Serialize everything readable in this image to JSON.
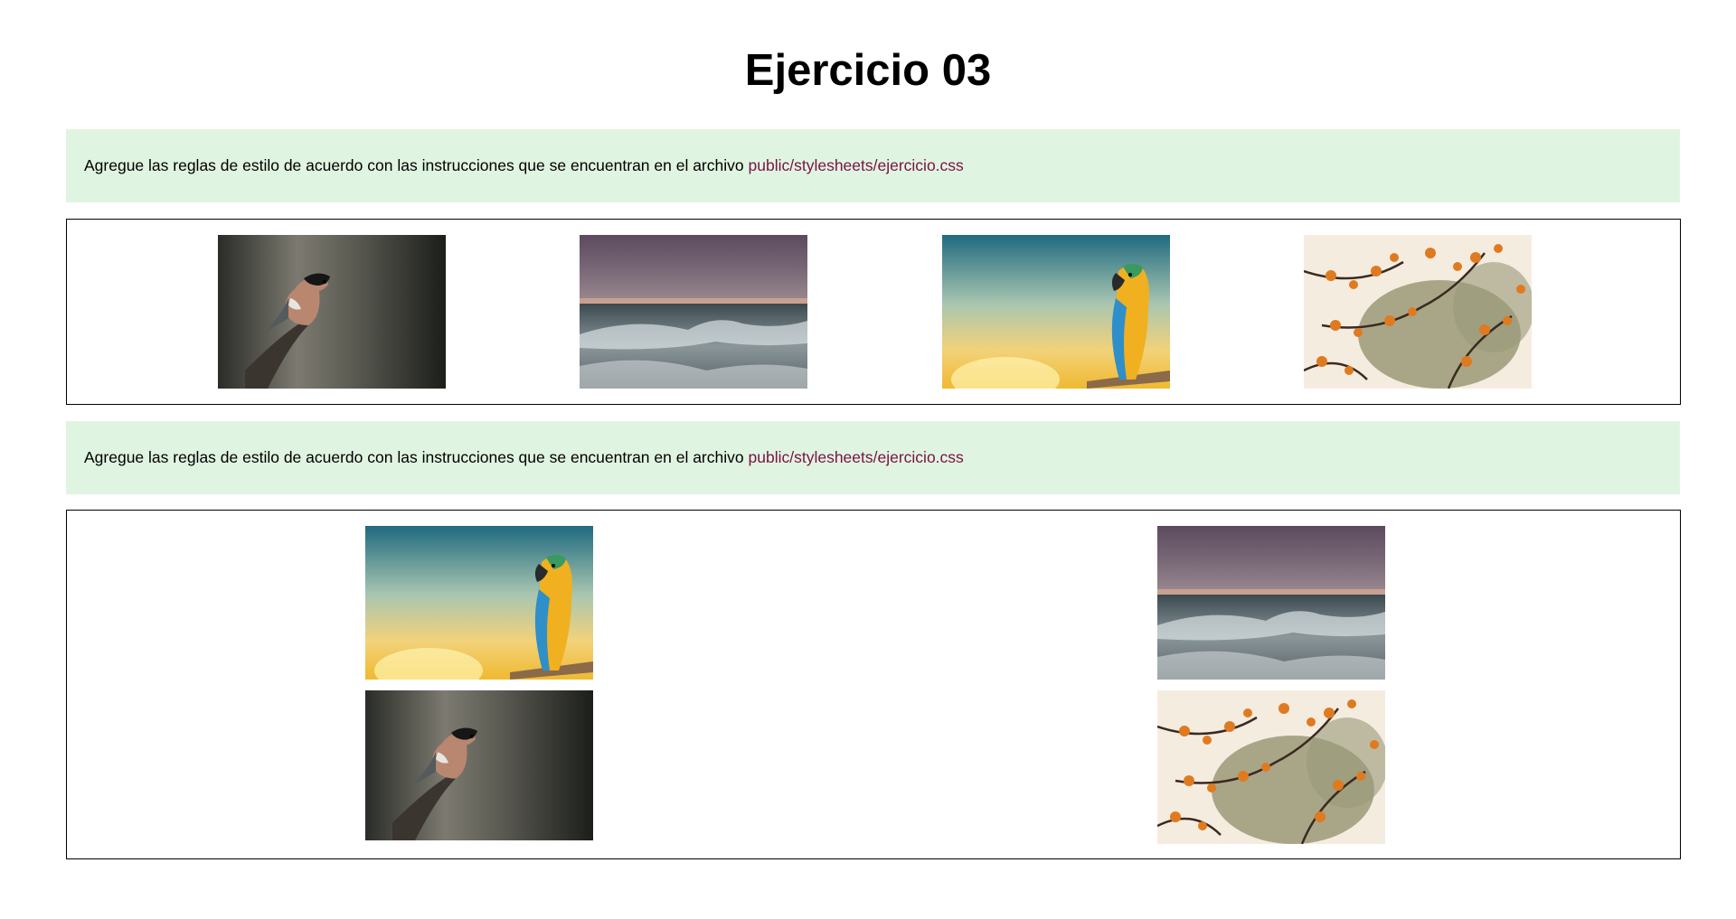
{
  "page": {
    "title": "Ejercicio 03"
  },
  "instructions": [
    {
      "text": "Agregue las reglas de estilo de acuerdo con las instrucciones que se encuentran en el archivo",
      "link": "public/stylesheets/ejercicio.css"
    },
    {
      "text": "Agregue las reglas de estilo de acuerdo con las instrucciones que se encuentran en el archivo",
      "link": "public/stylesheets/ejercicio.css"
    }
  ],
  "gallery_row": {
    "images": [
      "bird-photo",
      "ocean-wave-photo",
      "parrot-photo",
      "autumn-leaves-photo"
    ]
  },
  "gallery_grid": {
    "images": [
      "parrot-photo",
      "ocean-wave-photo",
      "bird-photo",
      "autumn-leaves-photo"
    ]
  },
  "colors": {
    "instructions_bg": "#e0f5e1",
    "link": "#7a1343",
    "border": "#000000"
  }
}
